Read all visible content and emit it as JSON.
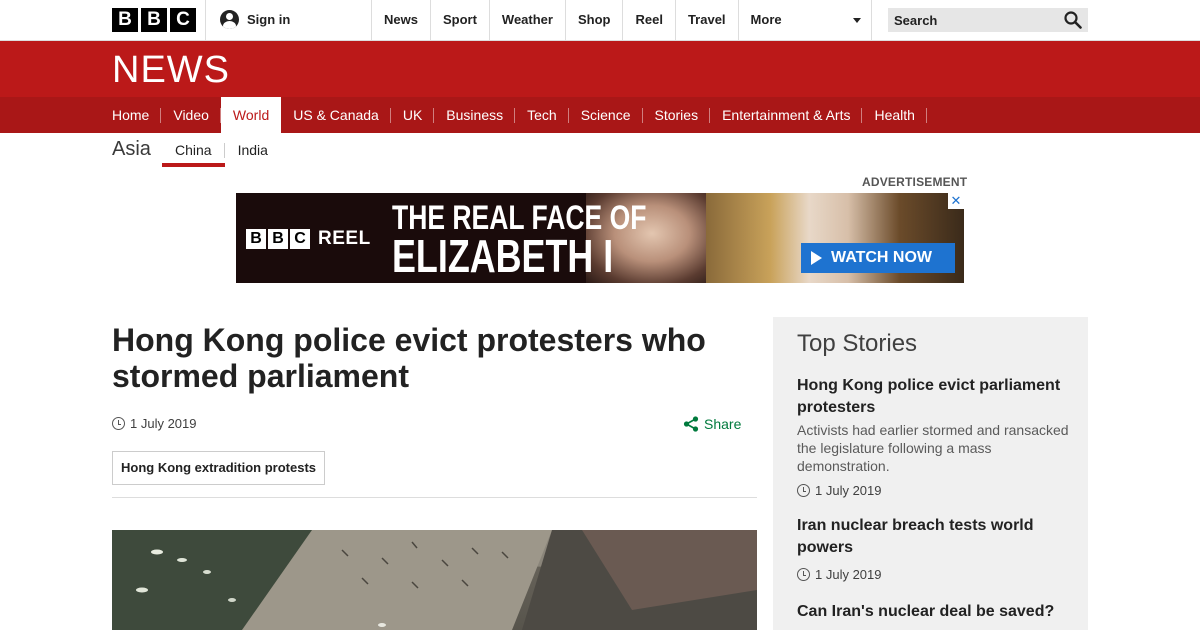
{
  "masthead": {
    "logo": [
      "B",
      "B",
      "C"
    ],
    "signin_label": "Sign in",
    "nav": [
      "News",
      "Sport",
      "Weather",
      "Shop",
      "Reel",
      "Travel",
      "More"
    ],
    "search_placeholder": "Search"
  },
  "section": {
    "title": "NEWS",
    "nav": [
      "Home",
      "Video",
      "World",
      "US & Canada",
      "UK",
      "Business",
      "Tech",
      "Science",
      "Stories",
      "Entertainment & Arts",
      "Health"
    ],
    "active": "World"
  },
  "subsection": {
    "title": "Asia",
    "nav": [
      "China",
      "India"
    ],
    "active": "China"
  },
  "advert": {
    "label": "ADVERTISEMENT",
    "brand_blocks": [
      "B",
      "B",
      "C"
    ],
    "brand_text": "REEL",
    "line1": "THE REAL FACE OF",
    "line2": "ELIZABETH I",
    "cta": "WATCH NOW",
    "close": "✕"
  },
  "article": {
    "headline": "Hong Kong police evict protesters who stormed parliament",
    "date": "1 July 2019",
    "share_label": "Share",
    "tag": "Hong Kong extradition protests"
  },
  "top_stories": {
    "title": "Top Stories",
    "items": [
      {
        "title": "Hong Kong police evict parliament protesters",
        "summary": "Activists had earlier stormed and ransacked the legislature following a mass demonstration.",
        "date": "1 July 2019"
      },
      {
        "title": "Iran nuclear breach tests world powers",
        "date": "1 July 2019"
      },
      {
        "title": "Can Iran's nuclear deal be saved?"
      }
    ]
  },
  "colors": {
    "brand_red": "#bb1919",
    "subnav_red": "#a91717",
    "share_green": "#007a3d",
    "cta_blue": "#1e73d0"
  }
}
